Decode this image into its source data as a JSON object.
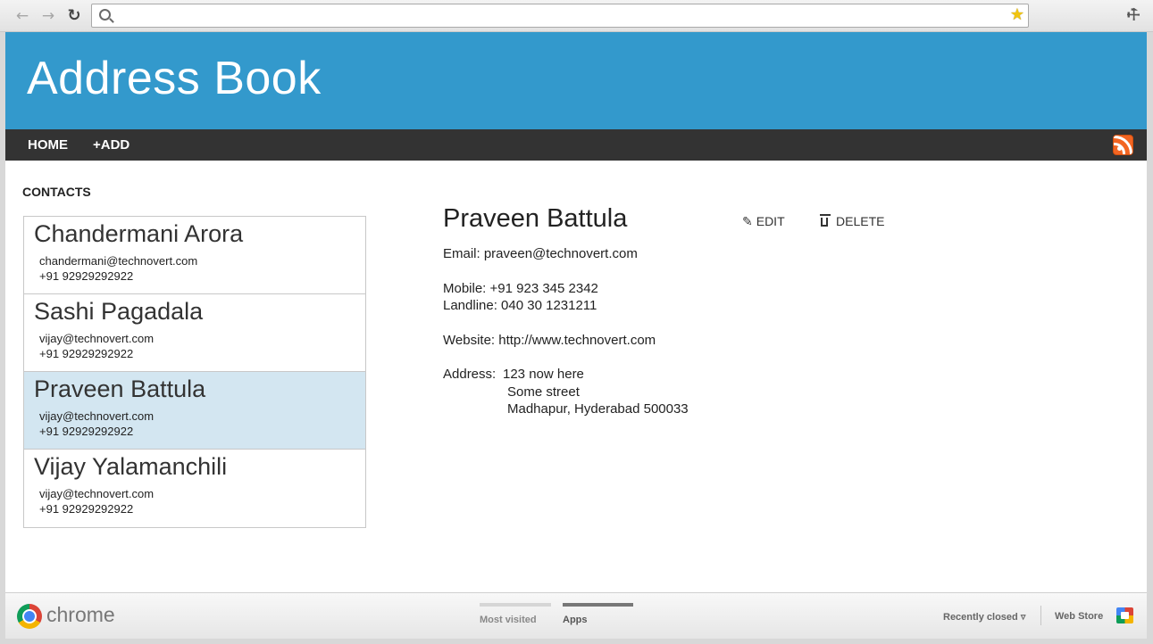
{
  "browser": {
    "back_icon": "←",
    "forward_icon": "→",
    "reload_icon": "↻",
    "url": "",
    "star_icon": "★",
    "wrench_icon": "🔧"
  },
  "app": {
    "title": "Address Book",
    "nav": {
      "home": "HOME",
      "add": "+ADD"
    },
    "rss_icon": "rss-feed",
    "accent_color": "#3399cc",
    "nav_color": "#333333"
  },
  "contacts": {
    "heading": "CONTACTS",
    "items": [
      {
        "name": "Chandermani Arora",
        "email": "chandermani@technovert.com",
        "phone": "+91 92929292922"
      },
      {
        "name": "Sashi Pagadala",
        "email": "vijay@technovert.com",
        "phone": "+91 92929292922"
      },
      {
        "name": "Praveen Battula",
        "email": "vijay@technovert.com",
        "phone": "+91 92929292922"
      },
      {
        "name": "Vijay Yalamanchili",
        "email": "vijay@technovert.com",
        "phone": "+91 92929292922"
      }
    ],
    "selected_index": 2,
    "selected_color": "#d3e6f1"
  },
  "detail": {
    "name": "Praveen Battula",
    "edit_label": "EDIT",
    "delete_label": "DELETE",
    "email": "Email: praveen@technovert.com",
    "mobile": "Mobile: +91 923 345 2342",
    "landline": "Landline: 040 30 1231211",
    "website": "Website: http://www.technovert.com",
    "address_label": "Address:",
    "address_lines": [
      "123 now here",
      "Some street",
      "Madhapur, Hyderabad 500033"
    ]
  },
  "footer": {
    "brand": "chrome",
    "tabs": [
      "Most visited",
      "Apps"
    ],
    "active_tab": "Apps",
    "recently_closed": "Recently closed ▿",
    "web_store": "Web Store"
  }
}
